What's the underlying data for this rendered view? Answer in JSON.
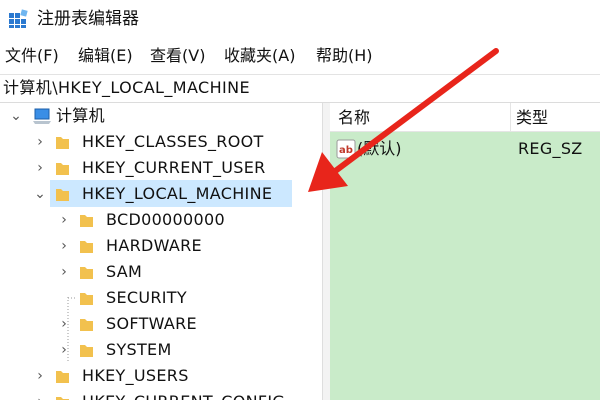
{
  "window": {
    "title": "注册表编辑器"
  },
  "menu": [
    {
      "label": "文件(F)"
    },
    {
      "label": "编辑(E)"
    },
    {
      "label": "查看(V)"
    },
    {
      "label": "收藏夹(A)"
    },
    {
      "label": "帮助(H)"
    }
  ],
  "address": {
    "path": "计算机\\HKEY_LOCAL_MACHINE"
  },
  "tree": {
    "root": "计算机",
    "hives": {
      "classes_root": "HKEY_CLASSES_ROOT",
      "current_user": "HKEY_CURRENT_USER",
      "local_machine": "HKEY_LOCAL_MACHINE",
      "users": "HKEY_USERS",
      "current_config": "HKEY_CURRENT_CONFIG"
    },
    "local_machine_children": {
      "bcd": "BCD00000000",
      "hardware": "HARDWARE",
      "sam": "SAM",
      "security": "SECURITY",
      "software": "SOFTWARE",
      "system": "SYSTEM"
    },
    "selected": "HKEY_LOCAL_MACHINE"
  },
  "list": {
    "columns": {
      "name": "名称",
      "type": "类型"
    },
    "rows": [
      {
        "name": "(默认)",
        "type": "REG_SZ",
        "icon": "string-value-icon"
      }
    ]
  },
  "colors": {
    "selection": "#cce8ff",
    "list_background": "#c9ebc9",
    "annotation_arrow": "#e8251b",
    "folder": "#f2c14e"
  }
}
